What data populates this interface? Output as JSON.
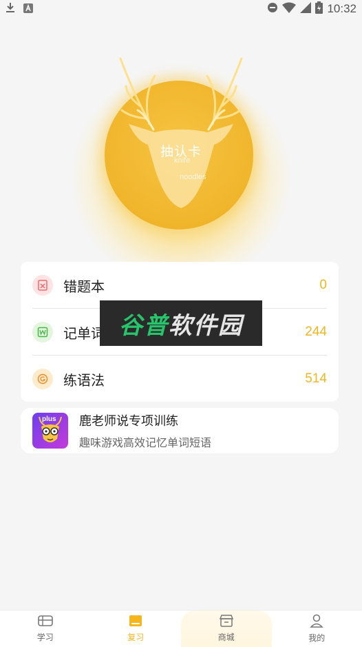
{
  "status_bar": {
    "time": "10:32",
    "left_icons": [
      "download-icon",
      "font-icon"
    ],
    "right_icons": [
      "dnd-icon",
      "wifi-icon",
      "signal-icon",
      "battery-charging-icon"
    ]
  },
  "hero": {
    "title": "抽认卡",
    "sub1": "knife",
    "sub2": "noodles",
    "icon": "deer-antler-icon"
  },
  "list": [
    {
      "label": "错题本",
      "count": "0",
      "icon": "wrongbook-icon",
      "icon_color": "#f06a6a",
      "icon_bg": "#fde3e3"
    },
    {
      "label": "记单词",
      "count": "244",
      "icon": "word-icon",
      "icon_color": "#45b649",
      "icon_bg": "#e3f6dd"
    },
    {
      "label": "练语法",
      "count": "514",
      "icon": "grammar-icon",
      "icon_color": "#f08b2c",
      "icon_bg": "#fdeccb"
    }
  ],
  "promo": {
    "title": "鹿老师说专项训练",
    "subtitle": "趣味游戏高效记忆单词短语",
    "badge": "plus"
  },
  "watermark": {
    "part1": "谷普",
    "part2": "软件园"
  },
  "nav": [
    {
      "label": "学习",
      "icon": "study-icon"
    },
    {
      "label": "复习",
      "icon": "review-icon"
    },
    {
      "label": "商城",
      "icon": "store-icon"
    },
    {
      "label": "我的",
      "icon": "profile-icon"
    }
  ],
  "colors": {
    "accent": "#f5b51d",
    "background": "#f5f5f5"
  }
}
